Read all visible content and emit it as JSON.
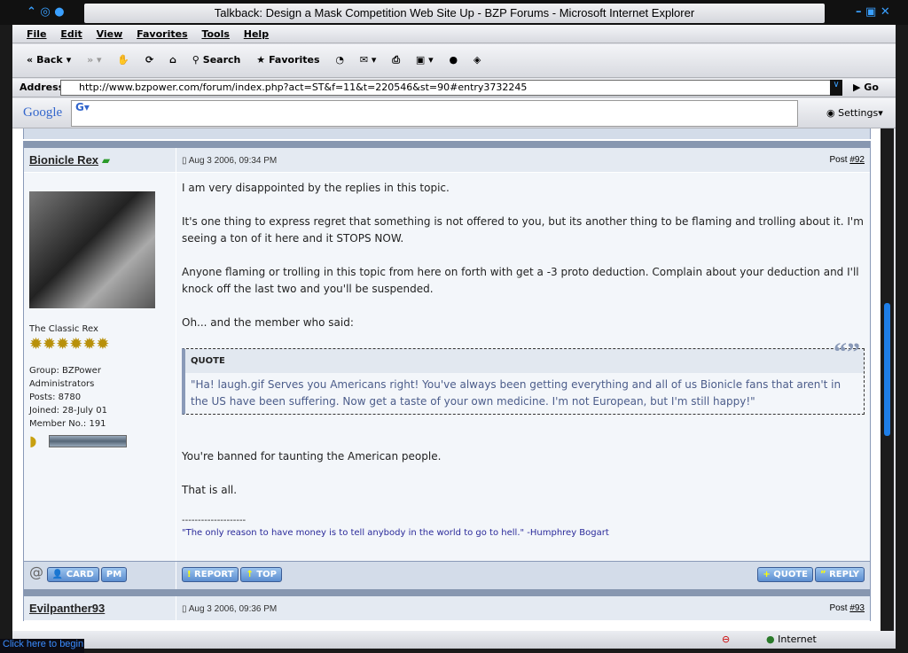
{
  "window": {
    "title": "Talkback: Design a Mask Competition Web Site Up - BZP Forums - Microsoft Internet Explorer"
  },
  "menu": [
    "File",
    "Edit",
    "View",
    "Favorites",
    "Tools",
    "Help"
  ],
  "toolbar": {
    "back": "Back",
    "search": "Search",
    "favorites": "Favorites"
  },
  "address": {
    "label": "Address",
    "url": "http://www.bzpower.com/forum/index.php?act=ST&f=11&t=220546&st=90#entry3732245",
    "go": "Go"
  },
  "google": {
    "logo": "Google",
    "settings": "Settings"
  },
  "post": {
    "author": "Bionicle Rex",
    "date": "Aug 3 2006, 09:34 PM",
    "post_label": "Post",
    "post_num": "#92",
    "user_title": "The Classic Rex",
    "info": [
      "Group: BZPower",
      "Administrators",
      "Posts: 8780",
      "Joined: 28-July 01",
      "Member No.: 191"
    ],
    "paragraphs": [
      "I am very disappointed by the replies in this topic.",
      "It's one thing to express regret that something is not offered to you, but its another thing to be flaming and trolling about it. I'm seeing a ton of it here and it STOPS NOW.",
      "Anyone flaming or trolling in this topic from here on forth with get a -3 proto deduction. Complain about your deduction and I'll knock off the last two and you'll be suspended.",
      "Oh... and the member who said:"
    ],
    "quote_label": "QUOTE",
    "quote_text": "\"Ha! laugh.gif Serves you Americans right! You've always been getting everything and all of us Bionicle fans that aren't in the US have been suffering. Now get a taste of your own medicine. I'm not European, but I'm still happy!\"",
    "after": [
      "You're banned for taunting the American people.",
      "That is all."
    ],
    "sig_line": "--------------------",
    "signature": "\"The only reason to have money is to tell anybody in the world to go to hell.\" -Humphrey Bogart",
    "buttons": {
      "card": "CARD",
      "pm": "PM",
      "report": "REPORT",
      "top": "TOP",
      "quote": "QUOTE",
      "reply": "REPLY"
    }
  },
  "next_post": {
    "author": "Evilpanther93",
    "date": "Aug 3 2006, 09:36 PM",
    "post_label": "Post",
    "post_num": "#93"
  },
  "status": {
    "zone": "Internet"
  },
  "taskbar": {
    "start": "Click here to begin"
  }
}
